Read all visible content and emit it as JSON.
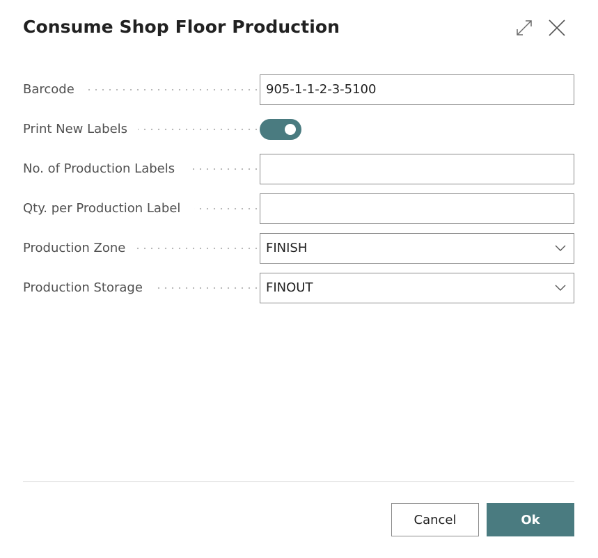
{
  "dialog": {
    "title": "Consume Shop Floor Production",
    "expand_icon": "expand-icon",
    "close_icon": "close-icon"
  },
  "fields": {
    "barcode": {
      "label": "Barcode",
      "value": "905-1-1-2-3-5100"
    },
    "print_new_labels": {
      "label": "Print New Labels",
      "enabled": true
    },
    "no_of_production_labels": {
      "label": "No. of Production Labels",
      "value": ""
    },
    "qty_per_production_label": {
      "label": "Qty. per Production Label",
      "value": ""
    },
    "production_zone": {
      "label": "Production Zone",
      "value": "FINISH"
    },
    "production_storage": {
      "label": "Production Storage",
      "value": "FINOUT"
    }
  },
  "footer": {
    "cancel_label": "Cancel",
    "ok_label": "Ok"
  },
  "colors": {
    "accent": "#4a7b80",
    "text": "#212121",
    "label": "#505050"
  }
}
